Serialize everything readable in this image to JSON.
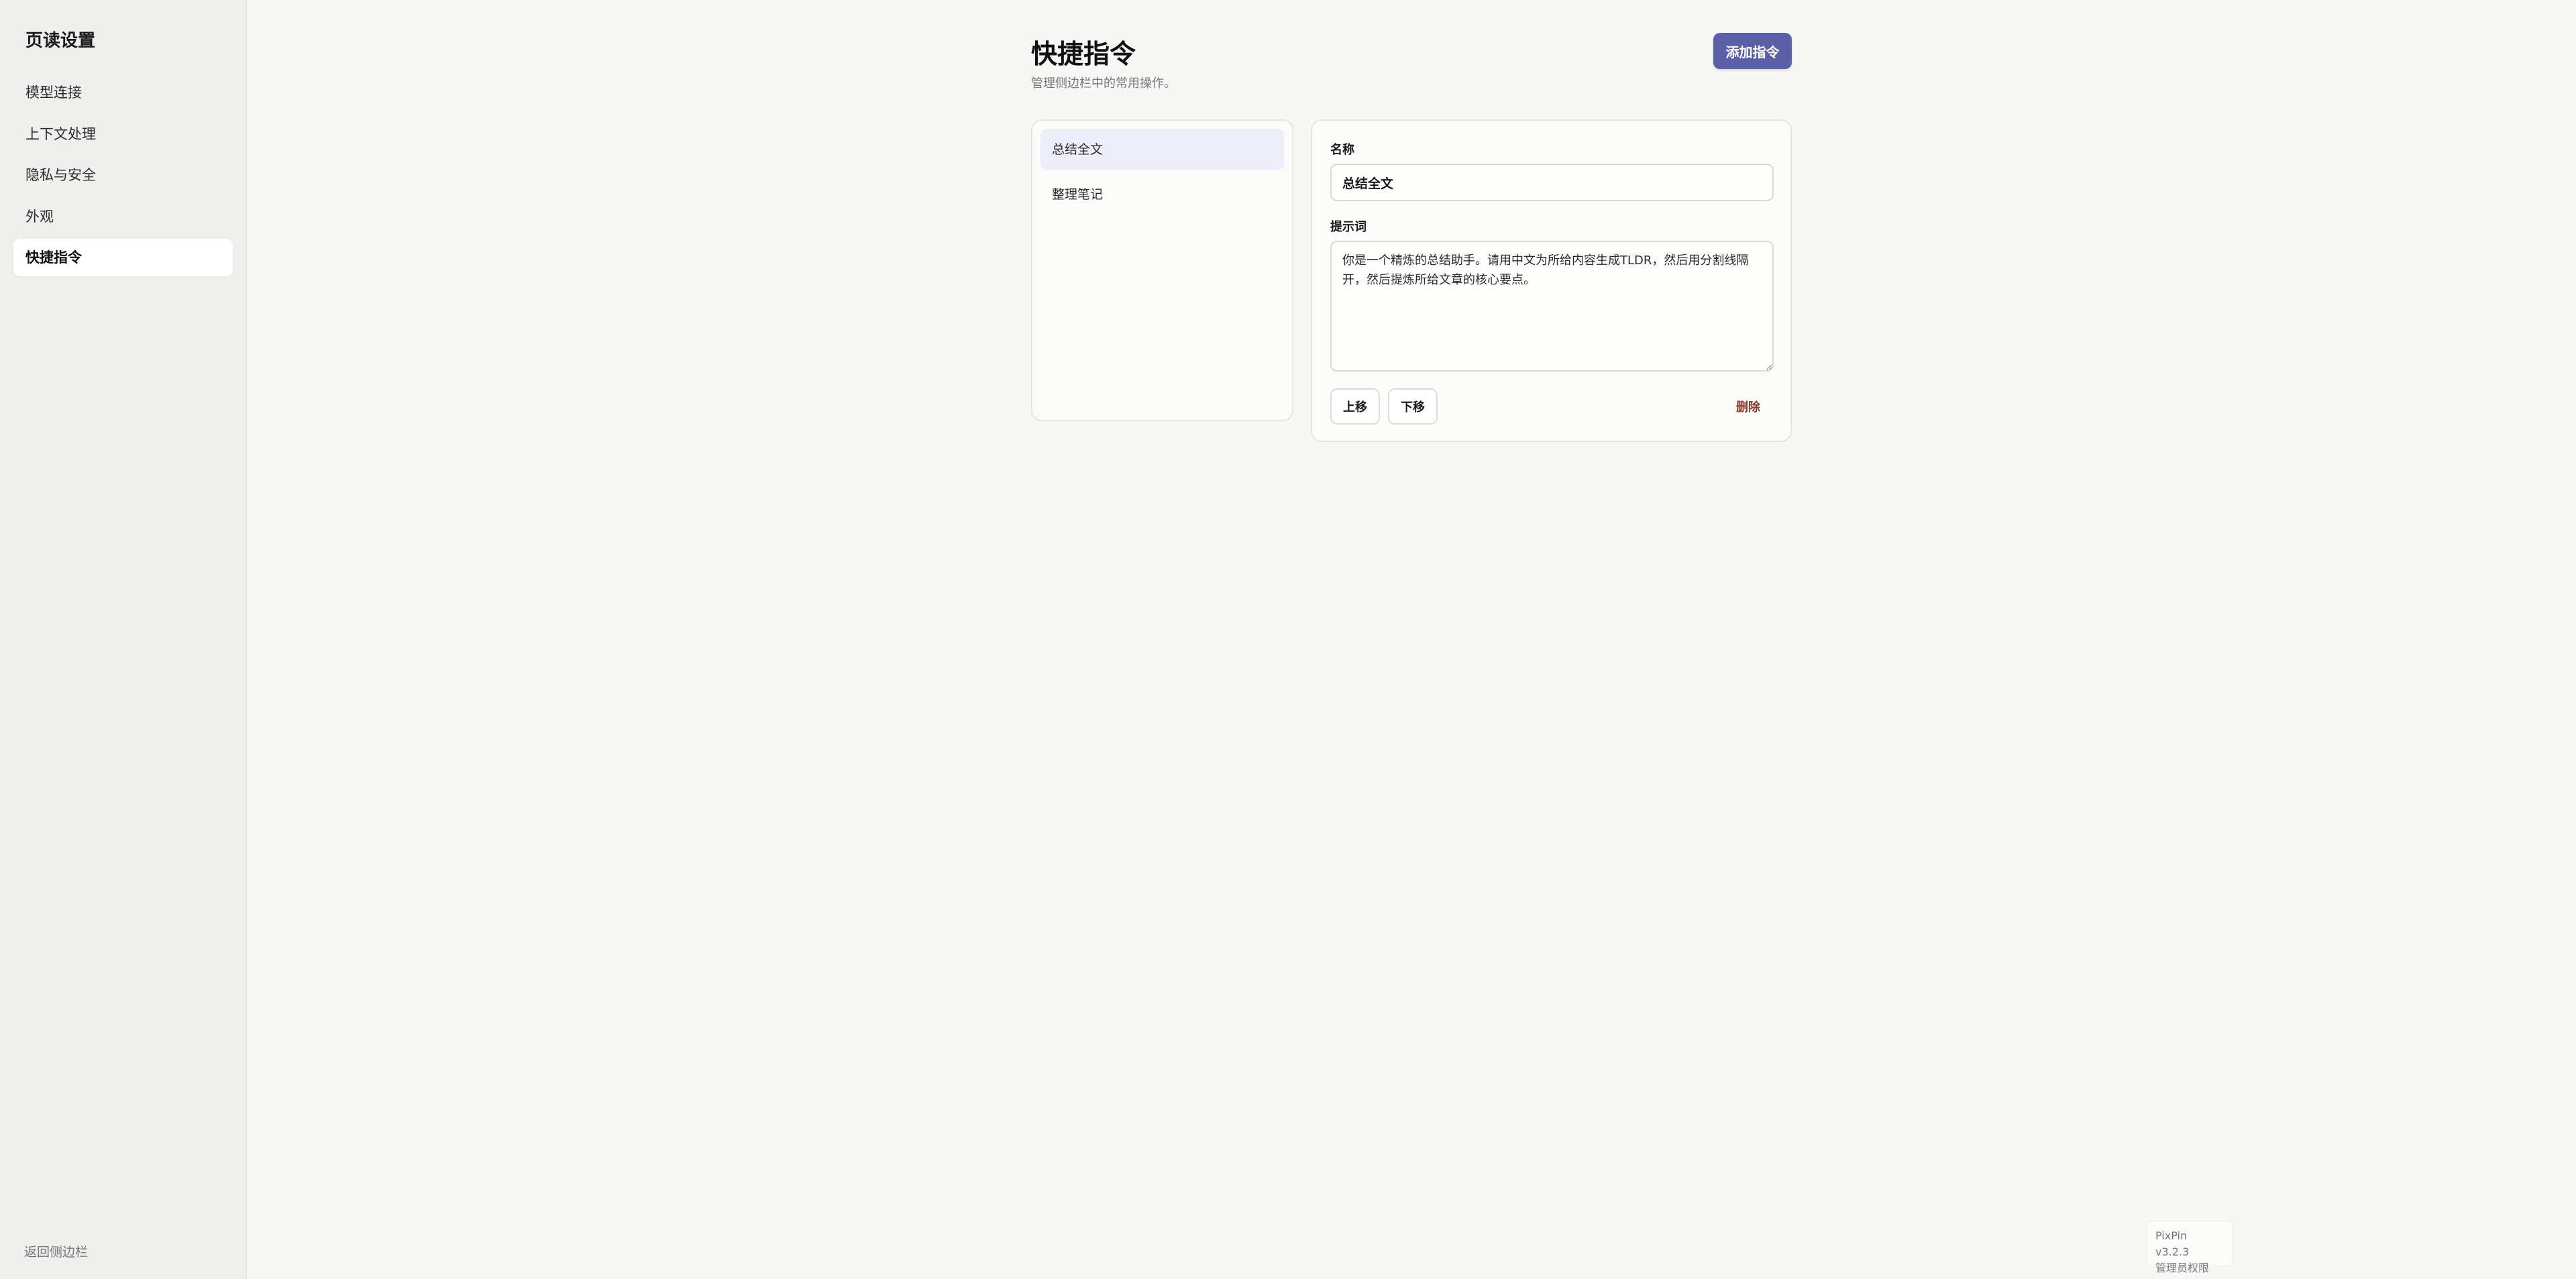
{
  "sidebar": {
    "title": "页读设置",
    "items": [
      {
        "label": "模型连接"
      },
      {
        "label": "上下文处理"
      },
      {
        "label": "隐私与安全"
      },
      {
        "label": "外观"
      },
      {
        "label": "快捷指令",
        "active": true
      }
    ],
    "back_label": "返回侧边栏"
  },
  "header": {
    "title": "快捷指令",
    "subtitle": "管理侧边栏中的常用操作。",
    "add_button_label": "添加指令"
  },
  "commands": [
    {
      "label": "总结全文",
      "active": true
    },
    {
      "label": "整理笔记"
    }
  ],
  "editor": {
    "name_label": "名称",
    "name_value": "总结全文",
    "prompt_label": "提示词",
    "prompt_value": "你是一个精炼的总结助手。请用中文为所给内容生成TLDR，然后用分割线隔开，然后提炼所给文章的核心要点。",
    "move_up_label": "上移",
    "move_down_label": "下移",
    "delete_label": "删除"
  },
  "badge": {
    "version": "PixPin v3.2.3",
    "permission": "管理员权限"
  },
  "colors": {
    "accent": "#5b5fa6",
    "active_list_bg": "#eeedfa",
    "delete": "#8a3a2a"
  }
}
